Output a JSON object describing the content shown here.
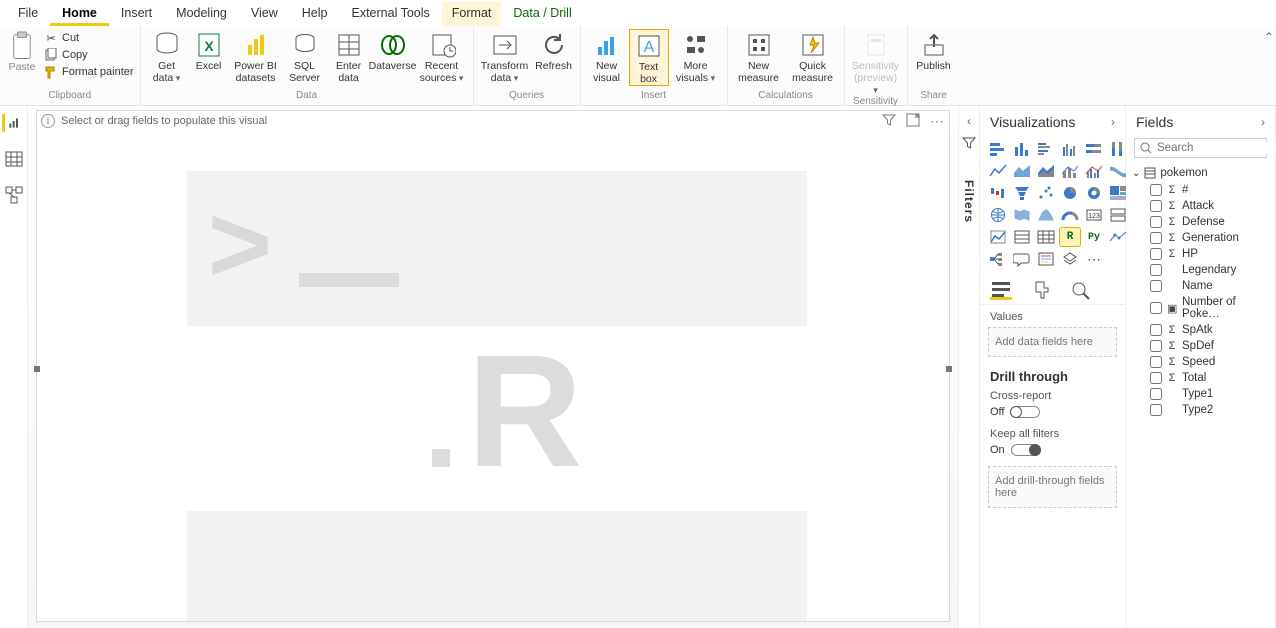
{
  "menu": {
    "file": "File",
    "home": "Home",
    "insert": "Insert",
    "modeling": "Modeling",
    "view": "View",
    "help": "Help",
    "external": "External Tools",
    "format": "Format",
    "dataDrill": "Data / Drill"
  },
  "ribbon": {
    "clipboard": {
      "group": "Clipboard",
      "paste": "Paste",
      "cut": "Cut",
      "copy": "Copy",
      "formatPainter": "Format painter"
    },
    "data": {
      "group": "Data",
      "getData": "Get data",
      "excel": "Excel",
      "pbiDatasets": "Power BI datasets",
      "sqlServer": "SQL Server",
      "enterData": "Enter data",
      "dataverse": "Dataverse",
      "recentSources": "Recent sources"
    },
    "queries": {
      "group": "Queries",
      "transform": "Transform data",
      "refresh": "Refresh"
    },
    "insert": {
      "group": "Insert",
      "newVisual": "New visual",
      "textBox": "Text box",
      "moreVisuals": "More visuals"
    },
    "calculations": {
      "group": "Calculations",
      "newMeasure": "New measure",
      "quickMeasure": "Quick measure"
    },
    "sensitivity": {
      "group": "Sensitivity",
      "sensitivity": "Sensitivity (preview)"
    },
    "share": {
      "group": "Share",
      "publish": "Publish"
    }
  },
  "canvas": {
    "hint": "Select or drag fields to populate this visual"
  },
  "filters": {
    "title": "Filters"
  },
  "viz": {
    "title": "Visualizations",
    "valuesLabel": "Values",
    "valuesWell": "Add data fields here",
    "drillTitle": "Drill through",
    "crossReport": "Cross-report",
    "crossReportState": "Off",
    "keepFilters": "Keep all filters",
    "keepFiltersState": "On",
    "drillWell": "Add drill-through fields here"
  },
  "fields": {
    "title": "Fields",
    "searchPlaceholder": "Search",
    "table": "pokemon",
    "items": [
      {
        "name": "#",
        "sigma": true
      },
      {
        "name": "Attack",
        "sigma": true
      },
      {
        "name": "Defense",
        "sigma": true
      },
      {
        "name": "Generation",
        "sigma": true
      },
      {
        "name": "HP",
        "sigma": true
      },
      {
        "name": "Legendary",
        "sigma": false
      },
      {
        "name": "Name",
        "sigma": false
      },
      {
        "name": "Number of Poke…",
        "sigma": false,
        "hier": true
      },
      {
        "name": "SpAtk",
        "sigma": true
      },
      {
        "name": "SpDef",
        "sigma": true
      },
      {
        "name": "Speed",
        "sigma": true
      },
      {
        "name": "Total",
        "sigma": true
      },
      {
        "name": "Type1",
        "sigma": false
      },
      {
        "name": "Type2",
        "sigma": false
      }
    ]
  }
}
